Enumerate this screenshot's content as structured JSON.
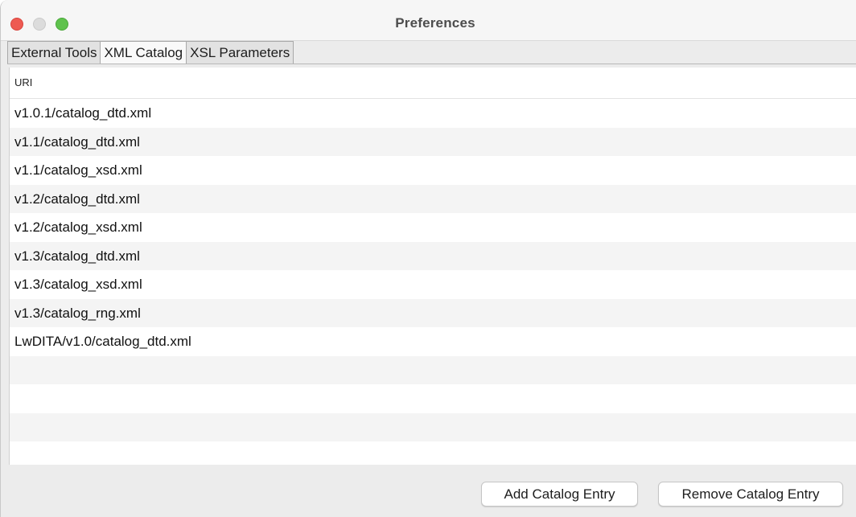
{
  "window": {
    "title": "Preferences"
  },
  "tabs": [
    {
      "label": "External Tools",
      "active": false
    },
    {
      "label": "XML Catalog",
      "active": true
    },
    {
      "label": "XSL Parameters",
      "active": false
    }
  ],
  "table": {
    "column_header": "URI",
    "rows": [
      "v1.0.1/catalog_dtd.xml",
      "v1.1/catalog_dtd.xml",
      "v1.1/catalog_xsd.xml",
      "v1.2/catalog_dtd.xml",
      "v1.2/catalog_xsd.xml",
      "v1.3/catalog_dtd.xml",
      "v1.3/catalog_xsd.xml",
      "v1.3/catalog_rng.xml",
      "LwDITA/v1.0/catalog_dtd.xml",
      "",
      "",
      "",
      ""
    ]
  },
  "buttons": {
    "add": "Add Catalog Entry",
    "remove": "Remove Catalog Entry"
  },
  "colors": {
    "close": "#ee5a52",
    "minimize": "#dcdcdc",
    "maximize": "#5fc24d",
    "row_alt": "#f4f4f4"
  }
}
